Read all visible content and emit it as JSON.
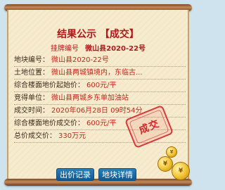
{
  "header": {
    "title": "结果公示 【成交】",
    "listing_label": "挂牌编号",
    "listing_no": "微山县2020-22号"
  },
  "rows": [
    {
      "label": "地块编号：",
      "value": "微山县2020-22号"
    },
    {
      "label": "土地位置：",
      "value": "微山县两城镇境内，东临古..."
    },
    {
      "label": "综合楼面地价起始价：",
      "value": "600元/平"
    },
    {
      "label": "竞得单位：",
      "value": "微山县两城乡东单加油站"
    },
    {
      "label": "成交时间：",
      "value": "2020年06月28日 09时54分"
    },
    {
      "label": "综合楼面地价成交价：",
      "value": "600元/平"
    },
    {
      "label": "总价成交价：",
      "value": "330万元"
    }
  ],
  "stamp": {
    "text": "成交"
  },
  "buttons": {
    "history": "出价记录",
    "detail": "地块详情"
  },
  "coins": {
    "symbol": "¥"
  }
}
